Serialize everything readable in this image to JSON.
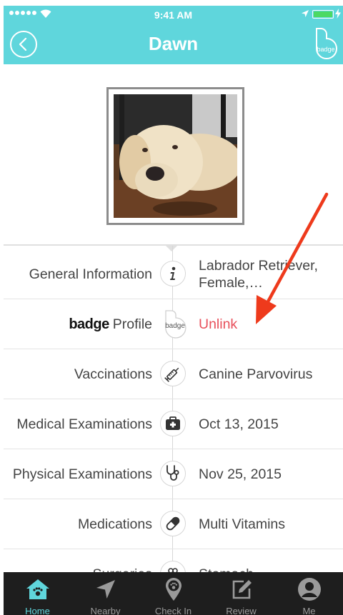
{
  "status_bar": {
    "time": "9:41 AM"
  },
  "nav": {
    "title": "Dawn",
    "badge_button_label": "badge"
  },
  "colors": {
    "accent": "#5fd6dc",
    "link_red": "#e8505b",
    "tabbar_bg": "#1e1e1e",
    "annotation_arrow": "#ee3a1c"
  },
  "profile": {
    "photo_icon": "dog-photo"
  },
  "rows": [
    {
      "label": "General Information",
      "icon": "info-icon",
      "value": "Labrador Retriever, Female,…"
    },
    {
      "label_brand": "badge",
      "label": "Profile",
      "icon": "badge-icon",
      "icon_text": "badge",
      "value": "Unlink"
    },
    {
      "label": "Vaccinations",
      "icon": "syringe-icon",
      "value": "Canine Parvovirus"
    },
    {
      "label": "Medical Examinations",
      "icon": "medical-kit-icon",
      "value": "Oct 13, 2015"
    },
    {
      "label": "Physical Examinations",
      "icon": "stethoscope-icon",
      "value": "Nov 25, 2015"
    },
    {
      "label": "Medications",
      "icon": "pill-icon",
      "value": "Multi Vitamins"
    },
    {
      "label": "Surgeries",
      "icon": "surgery-icon",
      "value": "Stomach"
    }
  ],
  "tabs": [
    {
      "label": "Home",
      "icon": "home-icon",
      "active": true
    },
    {
      "label": "Nearby",
      "icon": "location-arrow-icon",
      "active": false
    },
    {
      "label": "Check In",
      "icon": "map-pin-paw-icon",
      "active": false
    },
    {
      "label": "Review",
      "icon": "edit-icon",
      "active": false
    },
    {
      "label": "Me",
      "icon": "user-icon",
      "active": false
    }
  ]
}
